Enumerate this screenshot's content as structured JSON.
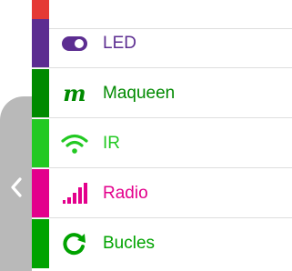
{
  "toolbox": {
    "categories": [
      {
        "id": "top",
        "label": "",
        "color": "#e53935",
        "icon": "none"
      },
      {
        "id": "led",
        "label": "LED",
        "color": "#5c2d91",
        "icon": "toggle-icon"
      },
      {
        "id": "maqueen",
        "label": "Maqueen",
        "color": "#008a00",
        "icon": "maqueen-m-icon"
      },
      {
        "id": "ir",
        "label": "IR",
        "color": "#22c922",
        "icon": "wifi-icon"
      },
      {
        "id": "radio",
        "label": "Radio",
        "color": "#e3008c",
        "icon": "signal-bars-icon"
      },
      {
        "id": "bucles",
        "label": "Bucles",
        "color": "#00a300",
        "icon": "loop-icon"
      }
    ]
  },
  "collapse_icon": "chevron-left-icon"
}
